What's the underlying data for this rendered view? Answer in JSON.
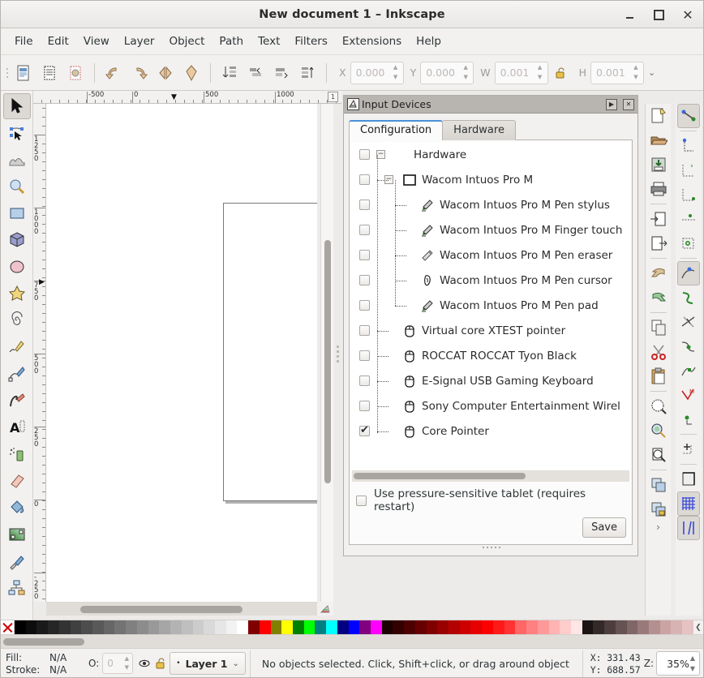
{
  "window": {
    "title": "New document 1 – Inkscape",
    "buttons": [
      {
        "name": "minimize-button",
        "label": "_"
      },
      {
        "name": "maximize-button",
        "label": "□"
      },
      {
        "name": "close-button",
        "label": "✕"
      }
    ]
  },
  "menubar": {
    "items": [
      "File",
      "Edit",
      "View",
      "Layer",
      "Object",
      "Path",
      "Text",
      "Filters",
      "Extensions",
      "Help"
    ]
  },
  "command_toolbar": {
    "icons": [
      "new-document-icon",
      "document-properties-icon",
      "document-preferences-icon",
      "undo-icon",
      "redo-icon",
      "duplicate-icon",
      "clone-icon",
      "raise-to-top-icon",
      "raise-icon",
      "lower-icon",
      "lower-to-bottom-icon"
    ],
    "fields": [
      {
        "label": "X",
        "value": "0.000"
      },
      {
        "label": "Y",
        "value": "0.000"
      },
      {
        "label": "W",
        "value": "0.001"
      },
      {
        "label": "H",
        "value": "0.001"
      }
    ],
    "lock_icon": "lock-open-icon",
    "overflow_icon": "chevron-down-icon"
  },
  "toolbox": {
    "tools": [
      {
        "name": "selector-tool",
        "icon": "arrow-cursor-icon",
        "active": true
      },
      {
        "name": "node-tool",
        "icon": "node-editor-icon",
        "active": false
      },
      {
        "name": "tweak-tool",
        "icon": "tweak-icon",
        "active": false
      },
      {
        "name": "zoom-tool",
        "icon": "magnifier-icon",
        "active": false
      },
      {
        "name": "rectangle-tool",
        "icon": "rectangle-icon",
        "active": false
      },
      {
        "name": "box3d-tool",
        "icon": "cube-icon",
        "active": false
      },
      {
        "name": "ellipse-tool",
        "icon": "ellipse-icon",
        "active": false
      },
      {
        "name": "star-tool",
        "icon": "star-icon",
        "active": false
      },
      {
        "name": "spiral-tool",
        "icon": "spiral-icon",
        "active": false
      },
      {
        "name": "pencil-tool",
        "icon": "pencil-icon",
        "active": false
      },
      {
        "name": "bezier-tool",
        "icon": "bezier-pen-icon",
        "active": false
      },
      {
        "name": "calligraphy-tool",
        "icon": "calligraphy-pen-icon",
        "active": false
      },
      {
        "name": "text-tool",
        "icon": "text-A-icon",
        "active": false
      },
      {
        "name": "spray-tool",
        "icon": "spray-can-icon",
        "active": false
      },
      {
        "name": "eraser-tool",
        "icon": "eraser-icon",
        "active": false
      },
      {
        "name": "paint-bucket-tool",
        "icon": "paint-bucket-icon",
        "active": false
      },
      {
        "name": "gradient-tool",
        "icon": "gradient-icon",
        "active": false
      },
      {
        "name": "dropper-tool",
        "icon": "eyedropper-icon",
        "active": false
      },
      {
        "name": "connector-tool",
        "icon": "connector-icon",
        "active": false
      }
    ]
  },
  "rulers": {
    "horizontal_labels": [
      "-500",
      "0",
      "500",
      "1000"
    ],
    "vertical_labels": [
      "1250",
      "1000",
      "750",
      "500",
      "250",
      "0",
      "-250"
    ],
    "unit_marker": "1"
  },
  "dialog": {
    "icon": "input-devices-icon",
    "title": "Input Devices",
    "titlebar_buttons": [
      {
        "name": "dialog-float-button",
        "glyph": "▶"
      },
      {
        "name": "dialog-close-button",
        "glyph": "✕"
      }
    ],
    "tabs": [
      {
        "label": "Configuration",
        "active": true
      },
      {
        "label": "Hardware",
        "active": false
      }
    ],
    "tree": [
      {
        "label": "Hardware",
        "checked": false,
        "depth": 0,
        "expander": "−",
        "icon": null
      },
      {
        "label": "Wacom Intuos Pro M",
        "checked": false,
        "depth": 1,
        "expander": "−",
        "icon": "tablet-icon"
      },
      {
        "label": "Wacom Intuos Pro M Pen stylus",
        "checked": false,
        "depth": 2,
        "expander": null,
        "icon": "stylus-icon"
      },
      {
        "label": "Wacom Intuos Pro M Finger touch",
        "checked": false,
        "depth": 2,
        "expander": null,
        "icon": "stylus-icon"
      },
      {
        "label": "Wacom Intuos Pro M Pen eraser",
        "checked": false,
        "depth": 2,
        "expander": null,
        "icon": "eraser-pen-icon"
      },
      {
        "label": "Wacom Intuos Pro M Pen cursor",
        "checked": false,
        "depth": 2,
        "expander": null,
        "icon": "puck-cursor-icon"
      },
      {
        "label": "Wacom Intuos Pro M Pen pad",
        "checked": false,
        "depth": 2,
        "expander": null,
        "icon": "stylus-icon"
      },
      {
        "label": "Virtual core XTEST pointer",
        "checked": false,
        "depth": 1,
        "expander": null,
        "icon": "mouse-icon"
      },
      {
        "label": "ROCCAT ROCCAT Tyon Black",
        "checked": false,
        "depth": 1,
        "expander": null,
        "icon": "mouse-icon"
      },
      {
        "label": "E-Signal USB Gaming Keyboard",
        "checked": false,
        "depth": 1,
        "expander": null,
        "icon": "mouse-icon"
      },
      {
        "label": "Sony Computer Entertainment Wirel",
        "checked": false,
        "depth": 1,
        "expander": null,
        "icon": "mouse-icon"
      },
      {
        "label": "Core Pointer",
        "checked": true,
        "depth": 1,
        "expander": null,
        "icon": "mouse-icon"
      }
    ],
    "pressure_checkbox": {
      "label": "Use pressure-sensitive tablet (requires restart)",
      "checked": false
    },
    "save_button": "Save"
  },
  "right_dock_commands": [
    {
      "name": "new-from-template-icon",
      "active": false
    },
    {
      "name": "open-icon",
      "active": false
    },
    {
      "name": "save-icon",
      "active": false
    },
    {
      "name": "print-icon",
      "active": false
    },
    {
      "sep": true
    },
    {
      "name": "import-icon",
      "active": false
    },
    {
      "name": "export-icon",
      "active": false
    },
    {
      "sep": true
    },
    {
      "name": "undo-history-icon",
      "active": false
    },
    {
      "name": "redo-history-icon",
      "active": false
    },
    {
      "sep": true
    },
    {
      "name": "copy-icon",
      "active": false
    },
    {
      "name": "cut-icon",
      "active": false
    },
    {
      "name": "paste-icon",
      "active": false
    },
    {
      "sep": true
    },
    {
      "name": "zoom-selection-icon",
      "active": false
    },
    {
      "name": "zoom-drawing-icon",
      "active": false
    },
    {
      "name": "zoom-page-icon",
      "active": false
    },
    {
      "sep": true
    },
    {
      "name": "group-icon",
      "active": false
    },
    {
      "name": "ungroup-icon",
      "active": false
    }
  ],
  "right_dock_snap": [
    {
      "name": "enable-snapping-icon",
      "active": true
    },
    {
      "sep": true
    },
    {
      "name": "snap-bounding-box-icon",
      "active": false
    },
    {
      "name": "snap-bbox-edge-icon",
      "active": false
    },
    {
      "name": "snap-bbox-corner-icon",
      "active": false
    },
    {
      "name": "snap-bbox-edge-midpoint-icon",
      "active": false
    },
    {
      "name": "snap-bbox-center-icon",
      "active": false
    },
    {
      "sep": true
    },
    {
      "name": "snap-nodes-paths-icon",
      "active": true
    },
    {
      "name": "snap-path-icon",
      "active": false
    },
    {
      "name": "snap-path-intersection-icon",
      "active": false
    },
    {
      "name": "snap-to-cusp-node-icon",
      "active": false
    },
    {
      "name": "snap-smooth-node-icon",
      "active": false
    },
    {
      "name": "snap-midpoint-icon",
      "active": false
    },
    {
      "name": "snap-object-center-icon",
      "active": false
    },
    {
      "sep": true
    },
    {
      "name": "snap-rotation-center-icon",
      "active": false
    },
    {
      "sep": true
    },
    {
      "name": "snap-page-border-icon",
      "active": false
    },
    {
      "name": "snap-grid-icon",
      "active": true
    },
    {
      "name": "snap-guide-icon",
      "active": true
    }
  ],
  "right_dock_more": "›",
  "palette": {
    "none_swatch": "none-color-swatch",
    "colors": [
      "#000000",
      "#0d0d0d",
      "#1a1a1a",
      "#262626",
      "#333333",
      "#404040",
      "#4d4d4d",
      "#595959",
      "#666666",
      "#737373",
      "#808080",
      "#8c8c8c",
      "#999999",
      "#a6a6a6",
      "#b3b3b3",
      "#bfbfbf",
      "#cccccc",
      "#d9d9d9",
      "#e6e6e6",
      "#f2f2f2",
      "#ffffff",
      "#800000",
      "#ff0000",
      "#808000",
      "#ffff00",
      "#008000",
      "#00ff00",
      "#008080",
      "#00ffff",
      "#000080",
      "#0000ff",
      "#800080",
      "#ff00ff",
      "#1a0000",
      "#330000",
      "#4d0000",
      "#660000",
      "#800000",
      "#990000",
      "#b30000",
      "#cc0000",
      "#e60000",
      "#ff0000",
      "#ff1a1a",
      "#ff3333",
      "#ff6666",
      "#ff8080",
      "#ff9999",
      "#ffb3b3",
      "#ffcccc",
      "#ffe6e6",
      "#1a1414",
      "#332929",
      "#4d3d3d",
      "#665252",
      "#806666",
      "#997a7a",
      "#b38f8f",
      "#cca3a3",
      "#d9b3b3",
      "#e6c2c2"
    ],
    "scroll_icon": "chevron-left-icon"
  },
  "statusbar": {
    "fill_label": "Fill:",
    "fill_value": "N/A",
    "stroke_label": "Stroke:",
    "stroke_value": "N/A",
    "opacity_label": "O:",
    "opacity_value": "0",
    "layer_visibility_icon": "eye-icon",
    "layer_lock_icon": "lock-open-icon",
    "layer_name": "Layer 1",
    "layer_chevron": "⌄",
    "message": "No objects selected. Click, Shift+click, or drag around object",
    "coord_x_label": "X:",
    "coord_x_value": "331.43",
    "coord_y_label": "Y:",
    "coord_y_value": "688.57",
    "zoom_label": "Z:",
    "zoom_value": "35%"
  }
}
